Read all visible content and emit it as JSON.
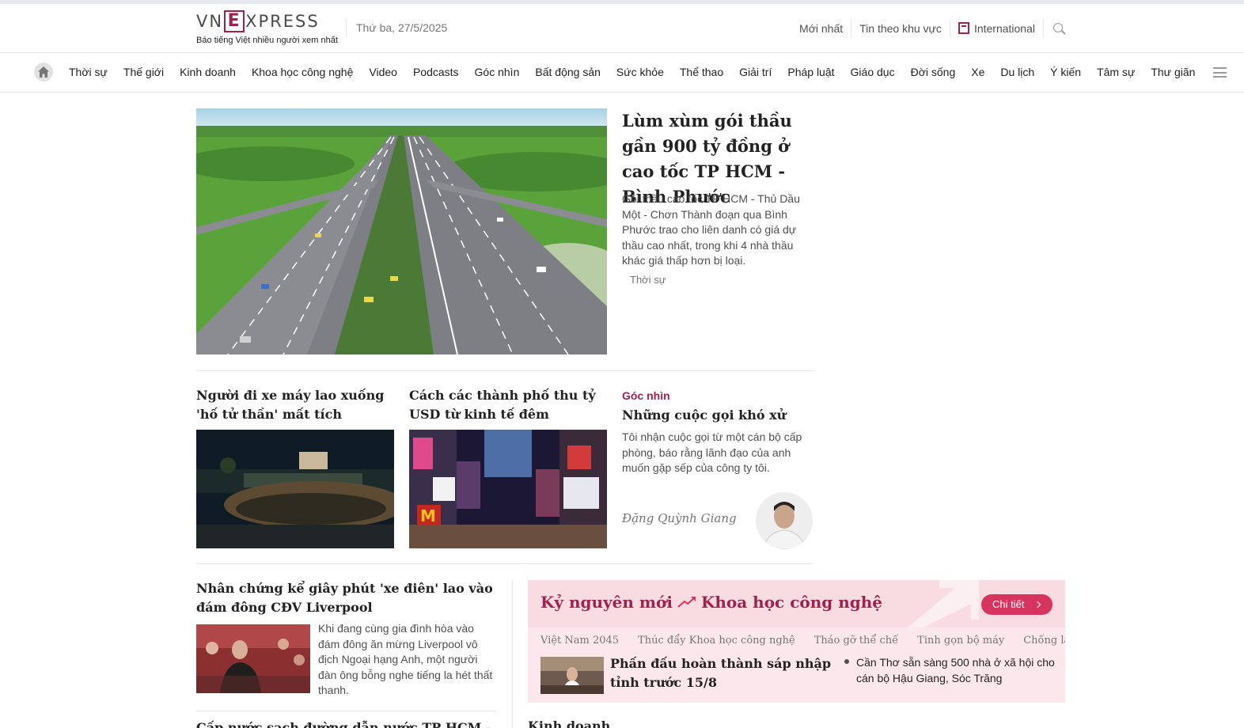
{
  "header": {
    "logo_text_left": "VN",
    "logo_text_e": "E",
    "logo_text_right": "XPRESS",
    "tagline": "Báo tiếng Việt nhiều người xem nhất",
    "date": "Thứ ba, 27/5/2025",
    "links": [
      "Mới nhất",
      "Tin theo khu vực",
      "International"
    ]
  },
  "nav": {
    "items": [
      "Thời sự",
      "Thế giới",
      "Kinh doanh",
      "Khoa học công nghệ",
      "Video",
      "Podcasts",
      "Góc nhìn",
      "Bất động sản",
      "Sức khỏe",
      "Thể thao",
      "Giải trí",
      "Pháp luật",
      "Giáo dục",
      "Đời sống",
      "Xe",
      "Du lịch",
      "Ý kiến",
      "Tâm sự",
      "Thư giãn"
    ]
  },
  "hero": {
    "title": "Lùm xùm gói thầu gần 900 tỷ đồng ở cao tốc TP HCM - Bình Phước",
    "description": "Gói thầu cao tốc TP HCM - Thủ Dầu Một - Chơn Thành đoạn qua Bình Phước trao cho liên danh có giá dự thầu cao nhất, trong khi 4 nhà thầu khác giá thấp hơn bị loại.",
    "category": "Thời sự"
  },
  "row2": {
    "card1_title": "Người đi xe máy lao xuống 'hố tử thần' mất tích",
    "card2_title": "Cách các thành phố thu tỷ USD từ kinh tế đêm",
    "opinion_label": "Góc nhìn",
    "opinion_title": "Những cuộc gọi khó xử",
    "opinion_desc": "Tôi nhận cuộc gọi từ một cán bộ cấp phòng, báo rằng lãnh đạo của anh muốn gặp sếp của công ty tôi.",
    "opinion_author": "Đặng Quỳnh Giang"
  },
  "row3": {
    "story_title": "Nhân chứng kể giây phút 'xe điên' lao vào đám đông CĐV Liverpool",
    "story_desc": "Khi đang cùng gia đình hòa vào đám đông ăn mừng Liverpool vô địch Ngoại hạng Anh, một người đàn ông bỗng nghe tiếng la hét thất thanh.",
    "next_story_partial": "Cấp nước sạch đường dẫn nước TP HCM - L"
  },
  "promo": {
    "title_left": "Kỷ nguyên mới",
    "title_right": "Khoa học công nghệ",
    "button": "Chi tiết",
    "tags": [
      "Việt Nam 2045",
      "Thúc đẩy Khoa học công nghệ",
      "Tháo gỡ thể chế",
      "Tinh gọn bộ máy",
      "Chống lãng phí"
    ],
    "main_story": "Phấn đấu hoàn thành sáp nhập tỉnh trước 15/8",
    "side_story": "Cần Thơ sẵn sàng 500 nhà ở xã hội cho cán bộ Hậu Giang, Sóc Trăng",
    "below_partial": "Kinh doanh"
  },
  "colors": {
    "brand": "#9f224e",
    "promo_bg": "#fce8ec",
    "button": "#d6345e"
  }
}
